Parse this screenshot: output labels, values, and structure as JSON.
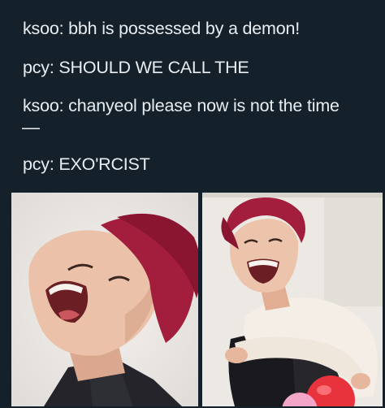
{
  "meme": {
    "lines": [
      "ksoo: bbh is possessed by a demon!",
      "pcy: SHOULD WE CALL THE",
      "ksoo: chanyeol please now is not the time",
      "—",
      "pcy: EXO'RCIST"
    ]
  },
  "photos": [
    {
      "subject": "laughing-man-red-hair-closeup"
    },
    {
      "subject": "laughing-man-red-hair-hugging-chair"
    }
  ],
  "colors": {
    "background": "#14212b",
    "text": "#e8edf1",
    "hair": "#a31d3c",
    "skin": "#e9bfa6"
  }
}
